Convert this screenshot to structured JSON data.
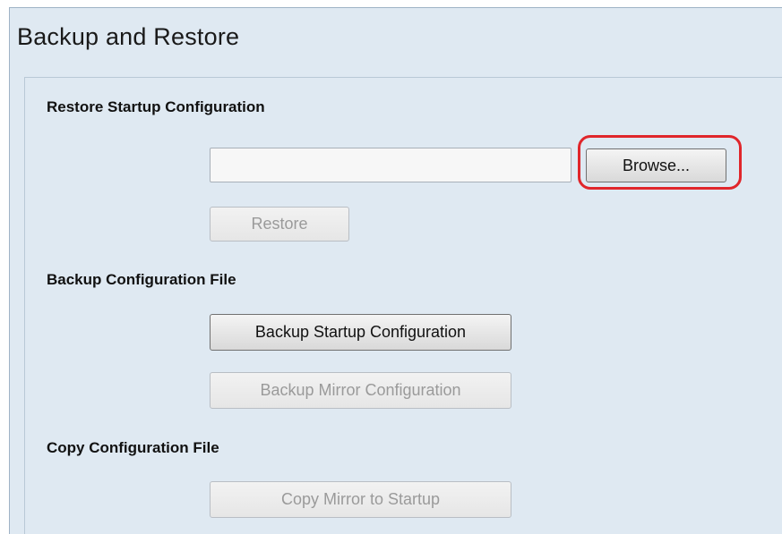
{
  "page": {
    "title": "Backup and Restore"
  },
  "restore": {
    "heading": "Restore Startup Configuration",
    "file_input_value": "",
    "browse_label": "Browse...",
    "restore_label": "Restore"
  },
  "backup": {
    "heading": "Backup Configuration File",
    "startup_label": "Backup Startup Configuration",
    "mirror_label": "Backup Mirror Configuration"
  },
  "copy": {
    "heading": "Copy Configuration File",
    "mirror_to_startup_label": "Copy Mirror to Startup"
  },
  "colors": {
    "panel_background": "#dfe9f2",
    "highlight_ring": "#e0262b",
    "disabled_text": "#9a9a9a"
  }
}
